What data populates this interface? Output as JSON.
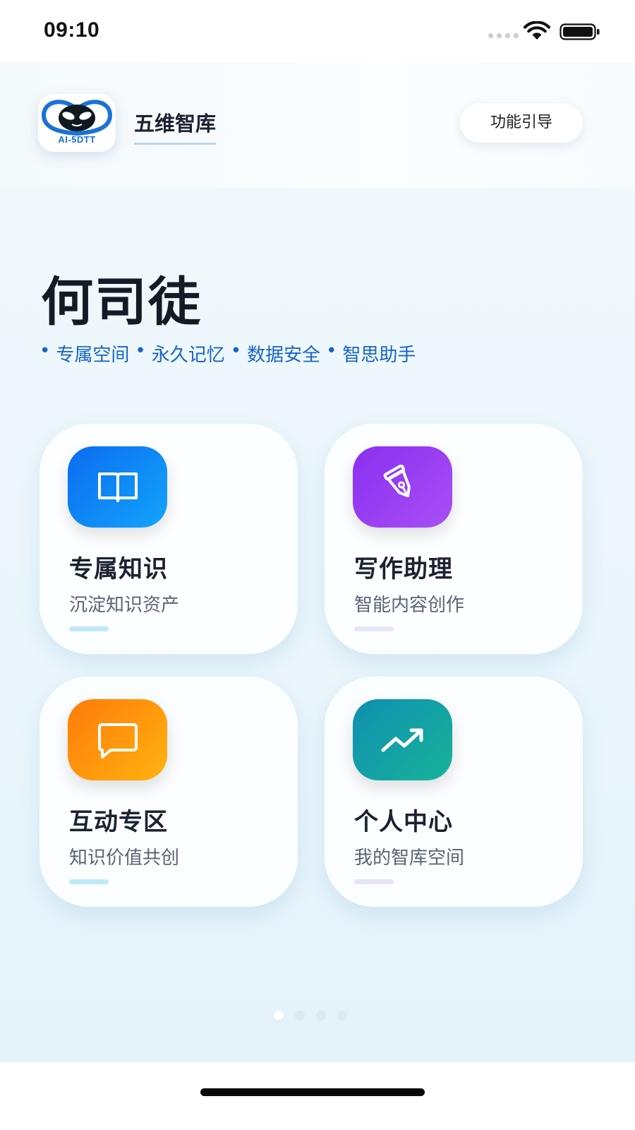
{
  "status_bar": {
    "time": "09:10"
  },
  "header": {
    "logo_text": "AI-5DTT",
    "app_name": "五维智库",
    "guide_button": "功能引导"
  },
  "hero": {
    "user_name": "何司徒",
    "features": [
      "专属空间",
      "永久记忆",
      "数据安全",
      "智思助手"
    ]
  },
  "cards": [
    {
      "title": "专属知识",
      "subtitle": "沉淀知识资产",
      "icon": "book-icon",
      "color": "#1a86f2",
      "accent": "#bfe9f8"
    },
    {
      "title": "写作助理",
      "subtitle": "智能内容创作",
      "icon": "pen-icon",
      "color": "#9b3ff0",
      "accent": "#e6e4f5"
    },
    {
      "title": "互动专区",
      "subtitle": "知识价值共创",
      "icon": "chat-icon",
      "color": "#ff9a0d",
      "accent": "#bfe9f8"
    },
    {
      "title": "个人中心",
      "subtitle": "我的智库空间",
      "icon": "trend-up-icon",
      "color": "#14a3a3",
      "accent": "#e6e4f5"
    }
  ],
  "pager": {
    "count": 4,
    "active": 1
  }
}
